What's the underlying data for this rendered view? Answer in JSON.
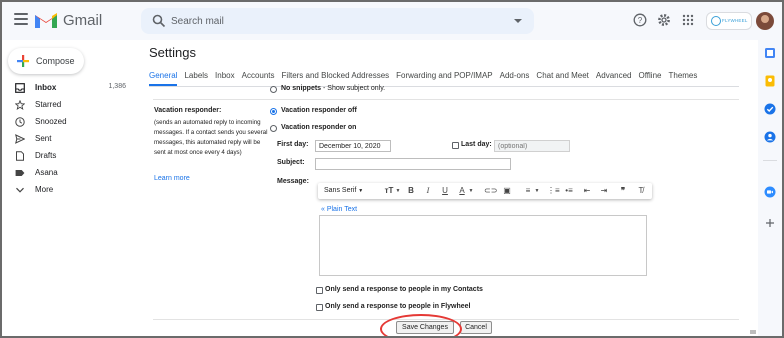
{
  "header": {
    "app_name": "Gmail",
    "search_placeholder": "Search mail",
    "account_label": "FLYWHEEL"
  },
  "sidebar": {
    "compose_label": "Compose",
    "items": [
      {
        "label": "Inbox",
        "count": "1,386",
        "icon": "inbox-icon"
      },
      {
        "label": "Starred",
        "count": "",
        "icon": "star-icon"
      },
      {
        "label": "Snoozed",
        "count": "",
        "icon": "clock-icon"
      },
      {
        "label": "Sent",
        "count": "",
        "icon": "send-icon"
      },
      {
        "label": "Drafts",
        "count": "",
        "icon": "draft-icon"
      },
      {
        "label": "Asana",
        "count": "",
        "icon": "label-icon"
      },
      {
        "label": "More",
        "count": "",
        "icon": "chevron-down-icon"
      }
    ]
  },
  "settings": {
    "title": "Settings",
    "tabs": [
      "General",
      "Labels",
      "Inbox",
      "Accounts",
      "Filters and Blocked Addresses",
      "Forwarding and POP/IMAP",
      "Add-ons",
      "Chat and Meet",
      "Advanced",
      "Offline",
      "Themes"
    ],
    "active_tab": "General",
    "no_snippets_label": "No snippets",
    "no_snippets_desc": " - Show subject only.",
    "vacation": {
      "title": "Vacation responder:",
      "description": "(sends an automated reply to incoming messages. If a contact sends you several messages, this automated reply will be sent at most once every 4 days)",
      "learn_more": "Learn more",
      "off_label": "Vacation responder off",
      "on_label": "Vacation responder on",
      "first_day_label": "First day:",
      "first_day_value": "December 10, 2020",
      "last_day_label": "Last day:",
      "last_day_placeholder": "(optional)",
      "subject_label": "Subject:",
      "subject_value": "",
      "message_label": "Message:",
      "font_name": "Sans Serif",
      "plain_text_link": "« Plain Text",
      "only_contacts_label": "Only send a response to people in my Contacts",
      "only_domain_label": "Only send a response to people in Flywheel"
    },
    "save_label": "Save Changes",
    "cancel_label": "Cancel"
  },
  "colors": {
    "accent": "#1a73e8",
    "highlight": "#e53935"
  }
}
